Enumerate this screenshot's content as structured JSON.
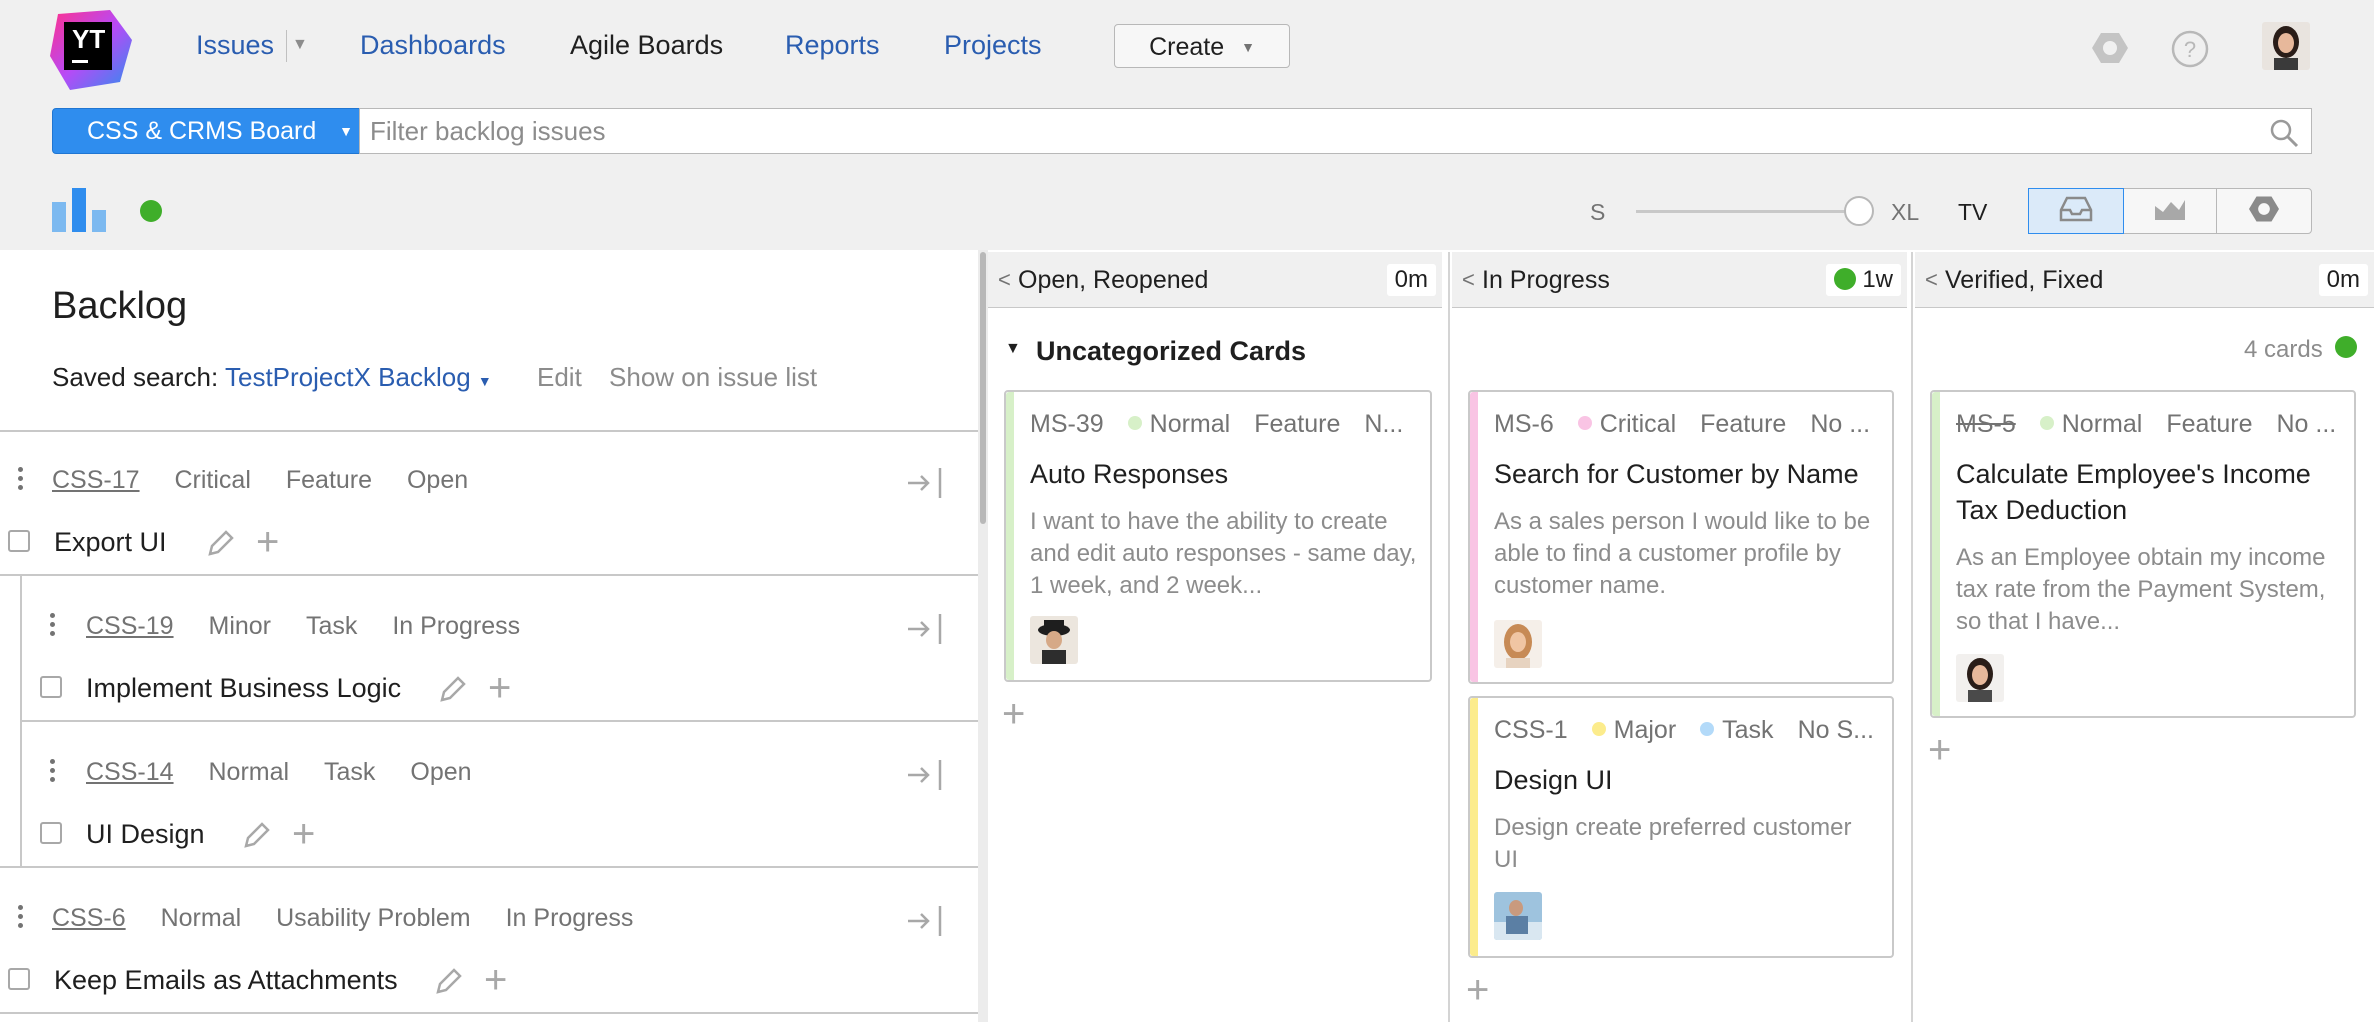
{
  "app": {
    "logo_text": "YT"
  },
  "nav": {
    "issues": "Issues",
    "dashboards": "Dashboards",
    "agile_boards": "Agile Boards",
    "reports": "Reports",
    "projects": "Projects",
    "create": "Create"
  },
  "toolbar": {
    "board_name": "CSS & CRMS Board",
    "filter_placeholder": "Filter backlog issues",
    "size_small": "S",
    "size_large": "XL",
    "tv": "TV",
    "size_slider_value": 1.0
  },
  "backlog": {
    "title": "Backlog",
    "saved_search_label": "Saved search:",
    "saved_search_value": "TestProjectX Backlog",
    "edit": "Edit",
    "show_on_issue_list": "Show on issue list",
    "items": [
      {
        "id": "CSS-17",
        "priority": "Critical",
        "type": "Feature",
        "state": "Open",
        "title": "Export UI"
      },
      {
        "id": "CSS-19",
        "priority": "Minor",
        "type": "Task",
        "state": "In Progress",
        "title": "Implement Business Logic"
      },
      {
        "id": "CSS-14",
        "priority": "Normal",
        "type": "Task",
        "state": "Open",
        "title": "UI Design"
      },
      {
        "id": "CSS-6",
        "priority": "Normal",
        "type": "Usability Problem",
        "state": "In Progress",
        "title": "Keep Emails as Attachments"
      }
    ]
  },
  "board": {
    "columns": [
      {
        "name": "Open, Reopened",
        "time": "0m"
      },
      {
        "name": "In Progress",
        "time": "1w"
      },
      {
        "name": "Verified, Fixed",
        "time": "0m"
      }
    ],
    "swimlane": {
      "title": "Uncategorized Cards",
      "count": "4 cards"
    },
    "cards": [
      {
        "id": "MS-39",
        "priority": "Normal",
        "type": "Feature",
        "extra": "N...",
        "title": "Auto Responses",
        "desc": "I want to have the ability to create and edit auto responses - same day, 1 week, and 2 week..."
      },
      {
        "id": "MS-6",
        "priority": "Critical",
        "type": "Feature",
        "extra": "No ...",
        "title": "Search for Customer by Name",
        "desc": "As a sales person I would like to be able to find a customer profile by customer name."
      },
      {
        "id": "CSS-1",
        "priority": "Major",
        "type": "Task",
        "extra": "No S...",
        "title": "Design UI",
        "desc": "Design create preferred customer UI"
      },
      {
        "id": "MS-5",
        "priority": "Normal",
        "type": "Feature",
        "extra": "No ...",
        "title": "Calculate Employee's Income Tax Deduction",
        "desc": "As an Employee obtain my income tax rate from the Payment System, so that I have..."
      }
    ]
  },
  "colors": {
    "accent": "#2f8dee",
    "normal": "#d7f0c8",
    "critical": "#f9c4e4",
    "major": "#fcec8c",
    "task": "#b3daf9",
    "status_green": "#3fae2a"
  }
}
